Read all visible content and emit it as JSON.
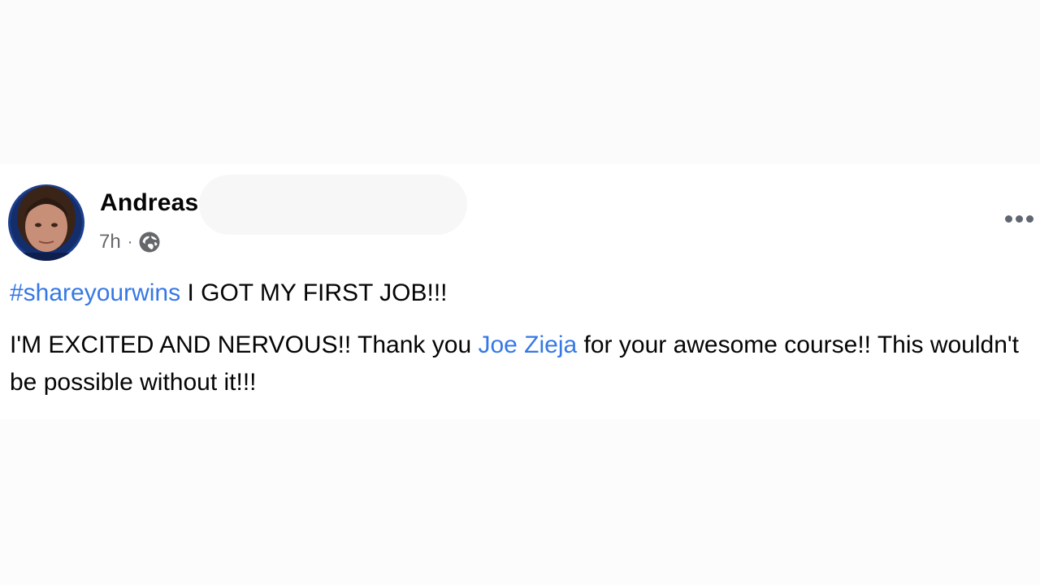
{
  "post": {
    "author": "Andreas",
    "timestamp": "7h",
    "separator": "·",
    "audience_icon": "public-globe-icon",
    "more_icon": "more-options-icon",
    "line1": {
      "hashtag": "#shareyourwins",
      "text": " I GOT MY FIRST JOB!!!"
    },
    "line2": {
      "before_mention": "I'M EXCITED AND NERVOUS!! Thank you ",
      "mention": "Joe Zieja",
      "after_mention": " for your awesome course!! This wouldn't be possible without it!!!"
    }
  },
  "colors": {
    "link": "#3578e5",
    "text": "#050505",
    "meta": "#65676b"
  }
}
